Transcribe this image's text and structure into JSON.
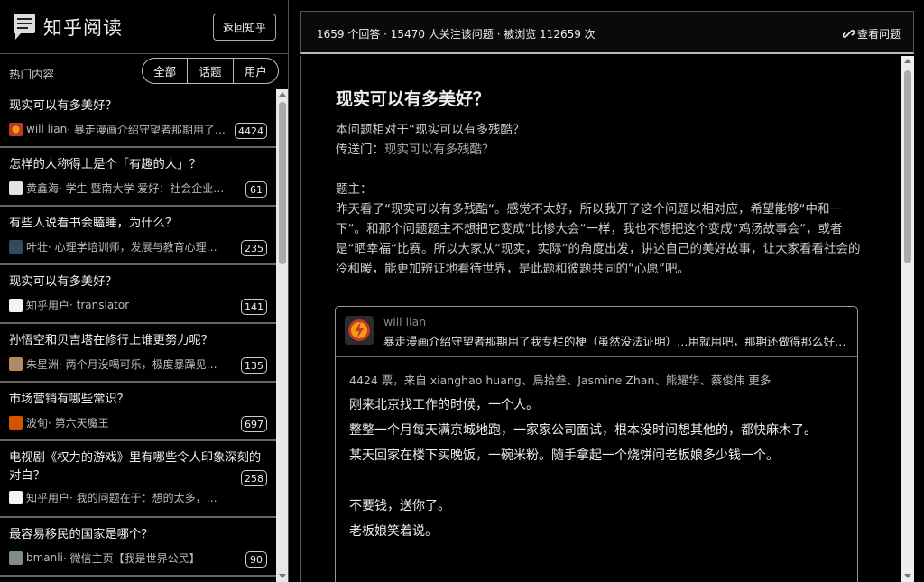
{
  "app": {
    "title": "知乎阅读",
    "back_button": "返回知乎",
    "logo_icon": "speech-bubble-icon"
  },
  "filter": {
    "label": "热门内容",
    "options": [
      "全部",
      "话题",
      "用户"
    ],
    "selected": "全部"
  },
  "questions": [
    {
      "title": "现实可以有多美好？",
      "author": "will lian",
      "bio": " · 暴走漫画介绍守望者那期用了…",
      "count": "4424",
      "avatar_color": "#c0392b"
    },
    {
      "title": "怎样的人称得上是个「有趣的人」？",
      "author": "黄鑫海",
      "bio": " · 学生 暨南大学 爱好：社会企业…",
      "count": "61",
      "avatar_color": "#dfe6e9"
    },
    {
      "title": "有些人说看书会瞌睡，为什么？",
      "author": "叶壮",
      "bio": " · 心理学培训师，发展与教育心理…",
      "count": "235",
      "avatar_color": "#34495e"
    },
    {
      "title": "现实可以有多美好？",
      "author": "知乎用户",
      "bio": " · translator",
      "count": "141",
      "avatar_color": "#f5f5f5"
    },
    {
      "title": "孙悟空和贝吉塔在修行上谁更努力呢？",
      "author": "朱星洲",
      "bio": " · 两个月没喝可乐，极度暴躁见…",
      "count": "135",
      "avatar_color": "#b08968"
    },
    {
      "title": "市场营销有哪些常识？",
      "author": "波旬",
      "bio": " · 第六天魔王",
      "count": "697",
      "avatar_color": "#d35400"
    },
    {
      "title": "电视剧《权力的游戏》里有哪些令人印象深刻的对白？",
      "author": "知乎用户",
      "bio": " · 我的问题在于：想的太多，…",
      "count": "258",
      "avatar_color": "#f5f5f5"
    },
    {
      "title": "最容易移民的国家是哪个？",
      "author": "bmanli",
      "bio": " · 微信主页【我是世界公民】",
      "count": "90",
      "avatar_color": "#7f8c8d"
    }
  ],
  "header": {
    "stats": "1659 个回答 · 15470 人关注该问题 · 被浏览 112659 次",
    "view_question": "查看问题"
  },
  "question": {
    "title": "现实可以有多美好？",
    "relative_prefix": "本问题相对于“现实可以有多残酷？",
    "portal_label": "传送门：",
    "portal_link": "现实可以有多残酷？",
    "op_label": "题主：",
    "op_text": "昨天看了“现实可以有多残酷“。感觉不太好，所以我开了这个问题以相对应，希望能够“中和一下“。和那个问题题主不想把它变成“比惨大会“一样，我也不想把这个变成“鸡汤故事会“，或者是“晒幸福“比赛。所以大家从“现实，实际”的角度出发，讲述自己的美好故事，让大家看看社会的冷和暖，能更加辨证地看待世界，是此题和彼题共同的“心愿”吧。"
  },
  "answer": {
    "author": "will lian",
    "bio": "暴走漫画介绍守望者那期用了我专栏的梗（虽然没法证明）…用就用吧，那期还做得那么好看…",
    "votes": "4424 票，来自 xianghao huang、鳥拾叁、Jasmine Zhan、熊耀华、蔡俊伟 更多",
    "paragraphs": [
      "刚来北京找工作的时候，一个人。",
      "整整一个月每天满京城地跑，一家家公司面试，根本没时间想其他的，都快麻木了。",
      "某天回家在楼下买晚饭，一碗米粉。随手拿起一个烧饼问老板娘多少钱一个。",
      "",
      "不要钱，送你了。",
      "老板娘笑着说。"
    ]
  }
}
